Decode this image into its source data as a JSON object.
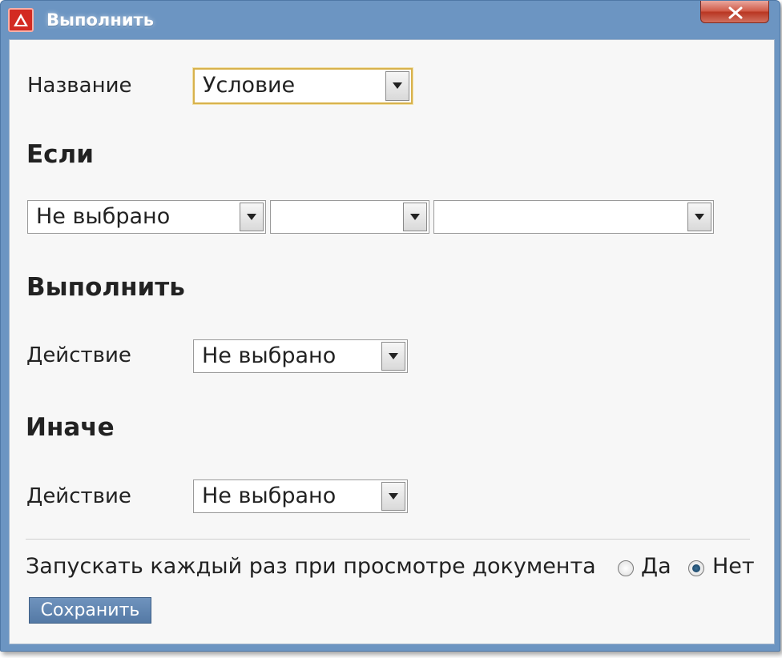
{
  "window": {
    "title": "Выполнить",
    "close_label": "x"
  },
  "form": {
    "name_label": "Название",
    "name_value": "Условие",
    "if_heading": "Если",
    "condition": {
      "field1_value": "Не выбрано",
      "field2_value": "",
      "field3_value": ""
    },
    "then_heading": "Выполнить",
    "then_action_label": "Действие",
    "then_action_value": "Не выбрано",
    "else_heading": "Иначе",
    "else_action_label": "Действие",
    "else_action_value": "Не выбрано",
    "run_each_time_label": "Запускать каждый раз при просмотре документа",
    "radio_yes_label": "Да",
    "radio_no_label": "Нет",
    "run_each_time_selected": "Нет",
    "save_label": "Сохранить"
  },
  "colors": {
    "frame": "#6c95c2",
    "content_bg": "#f7f7f7",
    "close_button": "#cf5744",
    "save_button": "#5f85b1",
    "focus_border": "#d8b24c"
  },
  "icons": {
    "app": "warning-triangle-icon",
    "close": "close-icon",
    "dropdown": "chevron-down-icon"
  }
}
